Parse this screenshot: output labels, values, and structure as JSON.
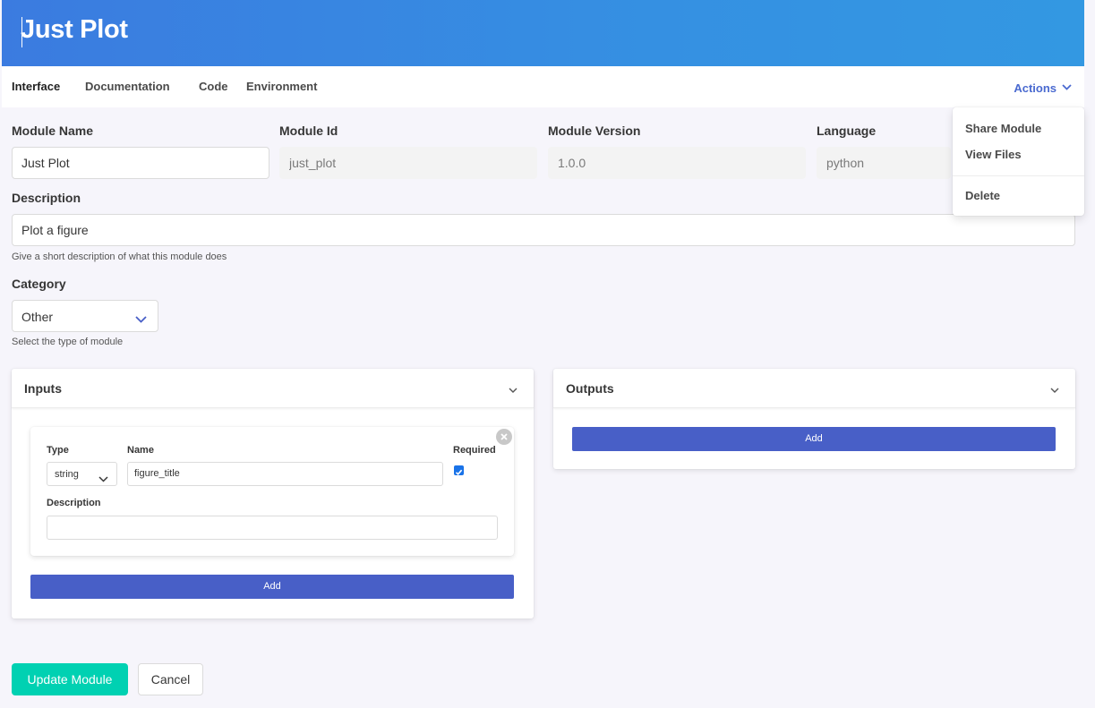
{
  "header": {
    "title": "Just Plot"
  },
  "tabs": [
    {
      "label": "Interface"
    },
    {
      "label": "Documentation"
    },
    {
      "label": "Code"
    },
    {
      "label": "Environment"
    }
  ],
  "actions": {
    "label": "Actions",
    "menu": [
      {
        "label": "Share Module"
      },
      {
        "label": "View Files"
      },
      {
        "label": "Delete"
      }
    ]
  },
  "form": {
    "module_name": {
      "label": "Module Name",
      "value": "Just Plot"
    },
    "module_id": {
      "label": "Module Id",
      "value": "just_plot"
    },
    "module_version": {
      "label": "Module Version",
      "value": "1.0.0"
    },
    "language": {
      "label": "Language",
      "value": "python"
    },
    "description": {
      "label": "Description",
      "value": "Plot a figure",
      "help": "Give a short description of what this module does"
    },
    "category": {
      "label": "Category",
      "value": "Other",
      "help": "Select the type of module"
    }
  },
  "inputs": {
    "title": "Inputs",
    "items": [
      {
        "type_label": "Type",
        "type_value": "string",
        "name_label": "Name",
        "name_value": "figure_title",
        "required_label": "Required",
        "required": true,
        "description_label": "Description",
        "description_value": ""
      }
    ],
    "add_label": "Add"
  },
  "outputs": {
    "title": "Outputs",
    "add_label": "Add"
  },
  "footer": {
    "update_label": "Update Module",
    "cancel_label": "Cancel"
  },
  "colors": {
    "header_gradient_start": "#3b7be0",
    "header_gradient_end": "#3398e2",
    "accent": "#485fc7",
    "primary": "#00d1b2",
    "link": "#4a6ad0"
  }
}
